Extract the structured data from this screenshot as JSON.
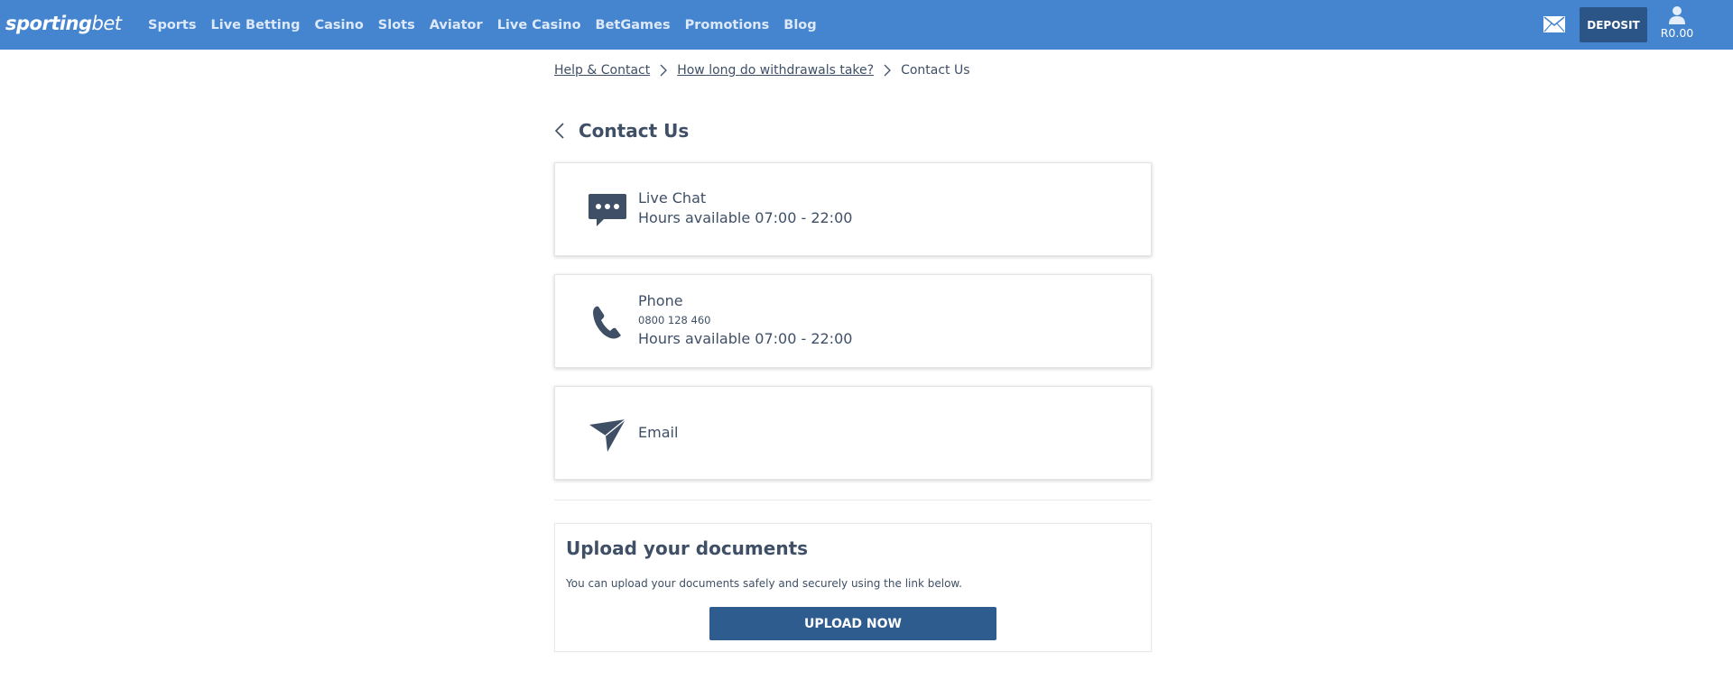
{
  "header": {
    "logo_main": "sporting",
    "logo_accent": "bet",
    "nav": [
      {
        "label": "Sports"
      },
      {
        "label": "Live Betting"
      },
      {
        "label": "Casino"
      },
      {
        "label": "Slots"
      },
      {
        "label": "Aviator"
      },
      {
        "label": "Live Casino"
      },
      {
        "label": "BetGames"
      },
      {
        "label": "Promotions"
      },
      {
        "label": "Blog"
      }
    ],
    "deposit_label": "DEPOSIT",
    "balance": "R0.00",
    "icons": {
      "mail": "mail-icon",
      "account": "user-icon"
    },
    "color_bar": "#4585d0",
    "color_button": "#2b5586"
  },
  "breadcrumb": {
    "items": [
      {
        "label": "Help & Contact"
      },
      {
        "label": "How long do withdrawals take?"
      }
    ],
    "current": "Contact Us"
  },
  "page": {
    "title": "Contact Us"
  },
  "contacts": {
    "live_chat": {
      "title": "Live Chat",
      "hours": "Hours available 07:00 - 22:00",
      "icon": "chat-bubble-icon"
    },
    "phone": {
      "title": "Phone",
      "number": "0800 128 460",
      "hours": "Hours available 07:00 - 22:00",
      "icon": "phone-icon"
    },
    "email": {
      "title": "Email",
      "icon": "paper-plane-icon"
    }
  },
  "upload": {
    "title": "Upload your documents",
    "description": "You can upload your documents safely and securely using the link below.",
    "button_label": "UPLOAD NOW"
  }
}
